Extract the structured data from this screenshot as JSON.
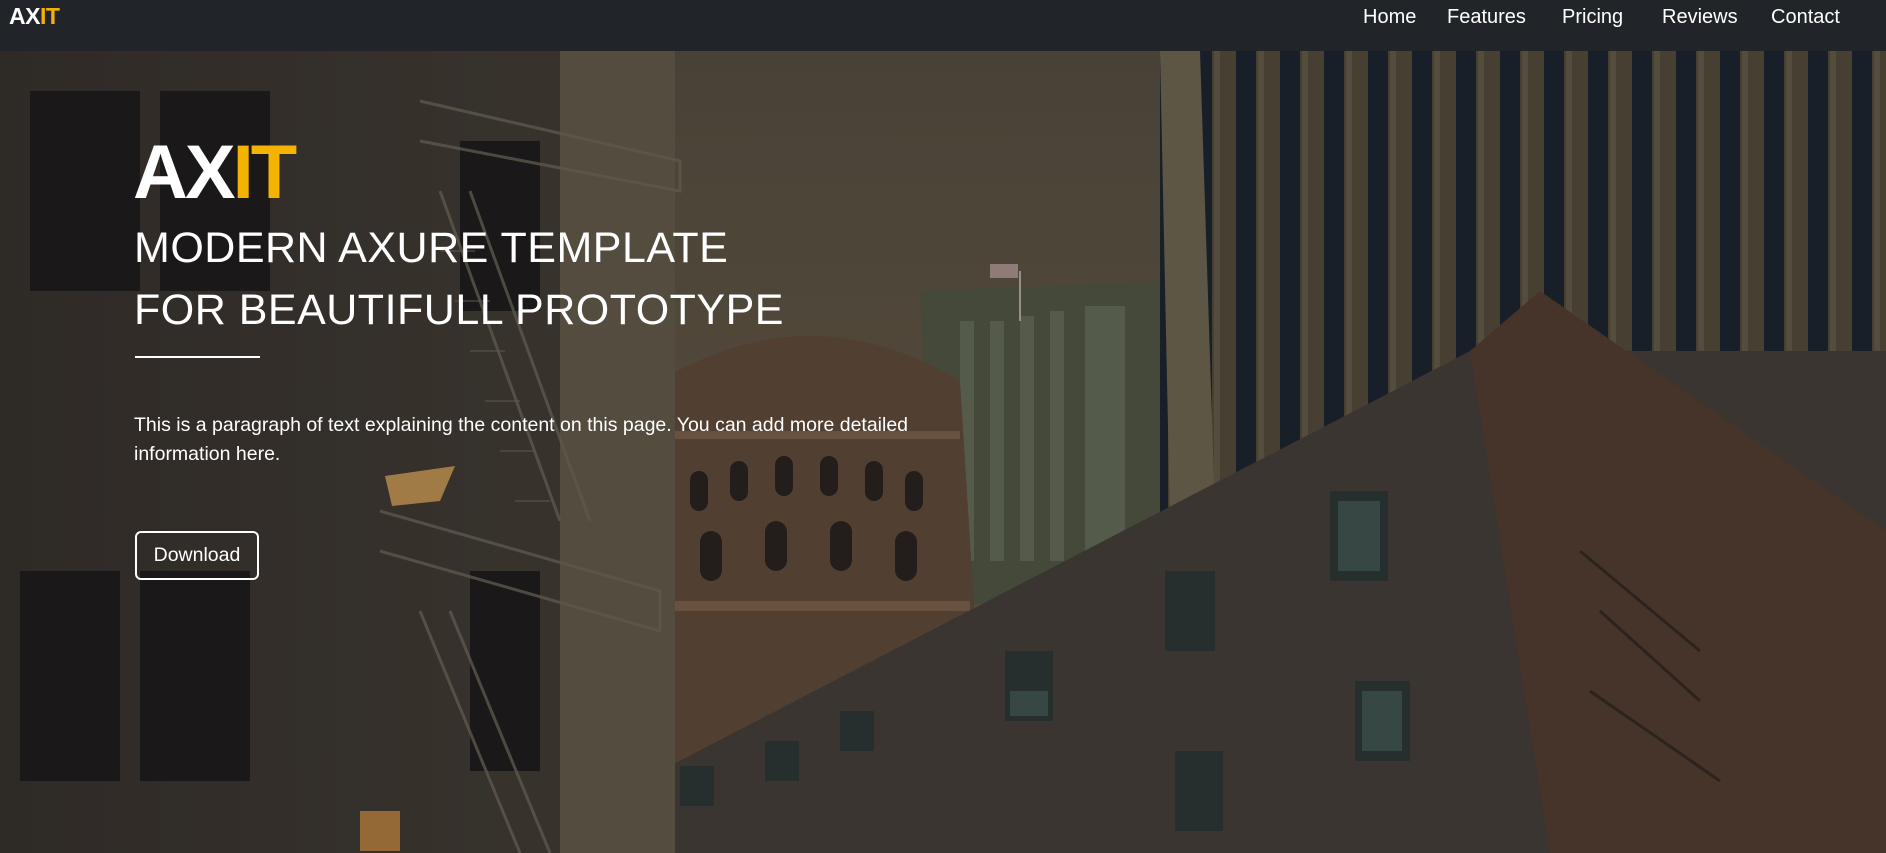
{
  "navbar": {
    "brand_prefix": "AX",
    "brand_highlight": "IT",
    "links": [
      {
        "label": "Home"
      },
      {
        "label": "Features"
      },
      {
        "label": "Pricing"
      },
      {
        "label": "Reviews"
      },
      {
        "label": "Contact"
      }
    ]
  },
  "hero": {
    "logo_prefix": "AX",
    "logo_highlight": "IT",
    "subtitle_line1": "MODERN AXURE TEMPLATE",
    "subtitle_line2": "FOR BEAUTIFULL PROTOTYPE",
    "paragraph": "This is a paragraph of text explaining the content on this page. You can add more detailed information here.",
    "button_label": "Download"
  },
  "colors": {
    "navbar_bg": "#212529",
    "accent": "#f5b301",
    "text": "#ffffff"
  }
}
